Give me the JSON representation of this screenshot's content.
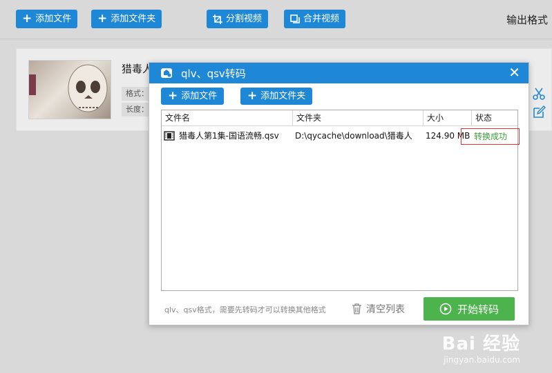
{
  "toolbar": {
    "add_file": "添加文件",
    "add_folder": "添加文件夹",
    "split_video": "分割视频",
    "merge_video": "合并视频",
    "output_format": "输出格式"
  },
  "file_item": {
    "title": "猎毒人",
    "format_label": "格式：",
    "length_label": "长度："
  },
  "dialog": {
    "title": "qlv、qsv转码",
    "close": "✕",
    "add_file": "添加文件",
    "add_folder": "添加文件夹",
    "columns": [
      "文件名",
      "文件夹",
      "大小",
      "状态"
    ],
    "rows": [
      {
        "name": "猎毒人第1集-国语流畅.qsv",
        "folder": "D:\\qycache\\download\\猎毒人",
        "size": "124.90 MB",
        "status": "转换成功"
      }
    ],
    "note": "qlv、qsv格式，需要先转码才可以转换其他格式",
    "clear_list": "清空列表",
    "start": "开始转码"
  },
  "watermark": {
    "brand": "Bai 经验",
    "url": "jingyan.baidu.com"
  },
  "colors": {
    "primary": "#1e88d6",
    "success": "#3ba33b",
    "start_button": "#4db34d",
    "highlight_border": "#dd3333"
  }
}
